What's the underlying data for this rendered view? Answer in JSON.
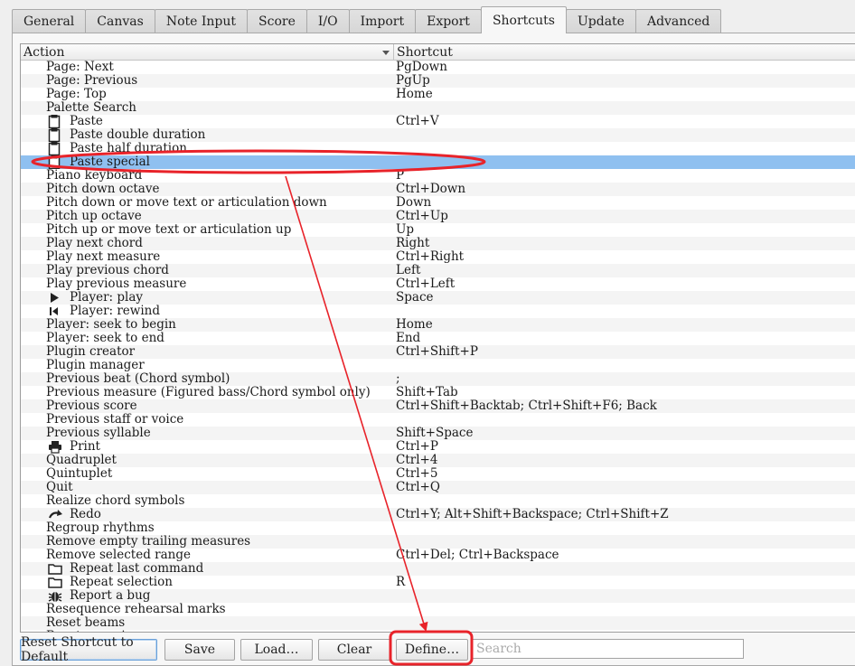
{
  "tabs": [
    "General",
    "Canvas",
    "Note Input",
    "Score",
    "I/O",
    "Import",
    "Export",
    "Shortcuts",
    "Update",
    "Advanced"
  ],
  "active_tab": "Shortcuts",
  "table": {
    "columns": {
      "action": "Action",
      "shortcut": "Shortcut"
    },
    "rows": [
      {
        "action": "Page: Next",
        "shortcut": "PgDown"
      },
      {
        "action": "Page: Previous",
        "shortcut": "PgUp"
      },
      {
        "action": "Page: Top",
        "shortcut": "Home"
      },
      {
        "action": "Palette Search",
        "shortcut": ""
      },
      {
        "action": "Paste",
        "shortcut": "Ctrl+V",
        "icon": "clipboard-icon"
      },
      {
        "action": "Paste double duration",
        "shortcut": "",
        "icon": "clipboard-icon"
      },
      {
        "action": "Paste half duration",
        "shortcut": "",
        "icon": "clipboard-icon"
      },
      {
        "action": "Paste special",
        "shortcut": "",
        "icon": "clipboard-icon",
        "selected": true
      },
      {
        "action": "Piano keyboard",
        "shortcut": "P"
      },
      {
        "action": "Pitch down octave",
        "shortcut": "Ctrl+Down"
      },
      {
        "action": "Pitch down or move text or articulation down",
        "shortcut": "Down"
      },
      {
        "action": "Pitch up octave",
        "shortcut": "Ctrl+Up"
      },
      {
        "action": "Pitch up or move text or articulation up",
        "shortcut": "Up"
      },
      {
        "action": "Play next chord",
        "shortcut": "Right"
      },
      {
        "action": "Play next measure",
        "shortcut": "Ctrl+Right"
      },
      {
        "action": "Play previous chord",
        "shortcut": "Left"
      },
      {
        "action": "Play previous measure",
        "shortcut": "Ctrl+Left"
      },
      {
        "action": "Player: play",
        "shortcut": "Space",
        "icon": "play-icon"
      },
      {
        "action": "Player: rewind",
        "shortcut": "",
        "icon": "rewind-icon"
      },
      {
        "action": "Player: seek to begin",
        "shortcut": "Home"
      },
      {
        "action": "Player: seek to end",
        "shortcut": "End"
      },
      {
        "action": "Plugin creator",
        "shortcut": "Ctrl+Shift+P"
      },
      {
        "action": "Plugin manager",
        "shortcut": ""
      },
      {
        "action": "Previous beat (Chord symbol)",
        "shortcut": ";"
      },
      {
        "action": "Previous measure (Figured bass/Chord symbol only)",
        "shortcut": "Shift+Tab"
      },
      {
        "action": "Previous score",
        "shortcut": "Ctrl+Shift+Backtab; Ctrl+Shift+F6; Back"
      },
      {
        "action": "Previous staff or voice",
        "shortcut": ""
      },
      {
        "action": "Previous syllable",
        "shortcut": "Shift+Space"
      },
      {
        "action": "Print",
        "shortcut": "Ctrl+P",
        "icon": "printer-icon"
      },
      {
        "action": "Quadruplet",
        "shortcut": "Ctrl+4"
      },
      {
        "action": "Quintuplet",
        "shortcut": "Ctrl+5"
      },
      {
        "action": "Quit",
        "shortcut": "Ctrl+Q"
      },
      {
        "action": "Realize chord symbols",
        "shortcut": ""
      },
      {
        "action": "Redo",
        "shortcut": "Ctrl+Y; Alt+Shift+Backspace; Ctrl+Shift+Z",
        "icon": "redo-icon"
      },
      {
        "action": "Regroup rhythms",
        "shortcut": ""
      },
      {
        "action": "Remove empty trailing measures",
        "shortcut": ""
      },
      {
        "action": "Remove selected range",
        "shortcut": "Ctrl+Del; Ctrl+Backspace"
      },
      {
        "action": "Repeat last command",
        "shortcut": "",
        "icon": "folder-icon"
      },
      {
        "action": "Repeat selection",
        "shortcut": "R",
        "icon": "folder-icon"
      },
      {
        "action": "Report a bug",
        "shortcut": "",
        "icon": "bug-icon"
      },
      {
        "action": "Resequence rehearsal marks",
        "shortcut": ""
      },
      {
        "action": "Reset beams",
        "shortcut": ""
      },
      {
        "action": "Reset groupings",
        "shortcut": ""
      }
    ]
  },
  "buttons": {
    "reset": "Reset Shortcut to Default",
    "save": "Save",
    "load": "Load…",
    "clear": "Clear",
    "define": "Define…"
  },
  "search": {
    "placeholder": "Search",
    "value": ""
  },
  "colors": {
    "selection": "#8fc0f0",
    "annotation": "#e8232a"
  }
}
